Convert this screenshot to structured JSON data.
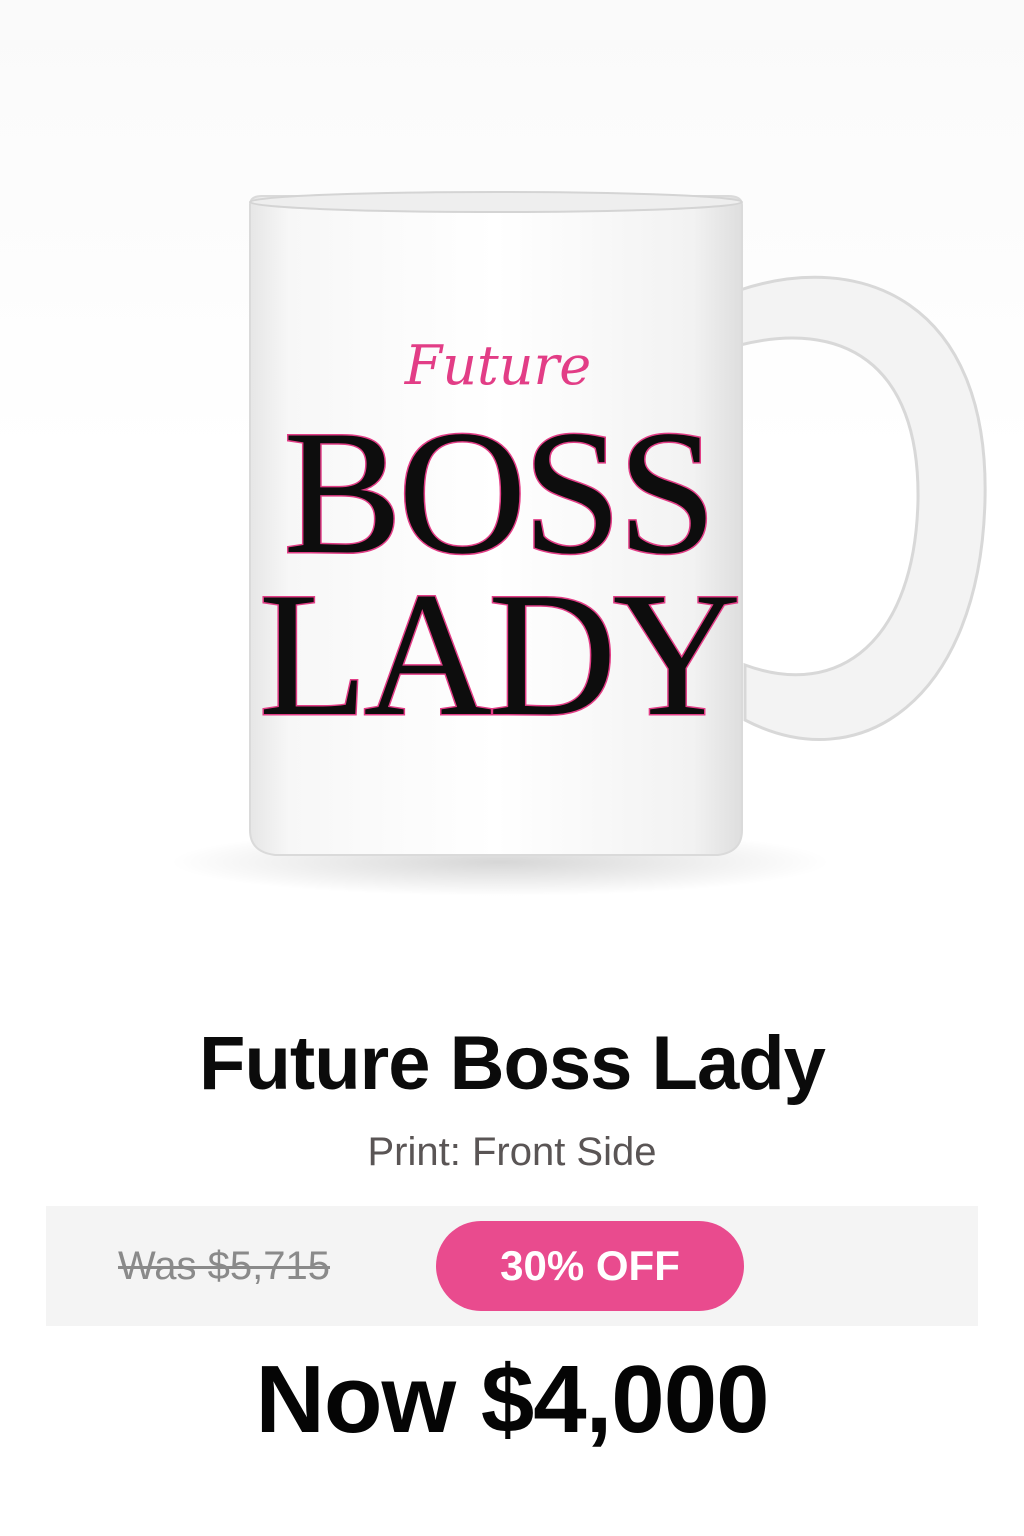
{
  "product": {
    "title": "Future Boss Lady",
    "print_option": "Print: Front Side",
    "image": {
      "description_icon": "mug-image",
      "print_text": {
        "line1": "Future",
        "line2": "BOSS",
        "line3": "LADY"
      }
    }
  },
  "pricing": {
    "was_price": "Was $5,715",
    "discount": "30% OFF",
    "now_price": "Now $4,000"
  },
  "colors": {
    "accent": "#e94b8e",
    "print_pink": "#e23d86",
    "text_dark": "#0b0b0b",
    "muted": "#8a8a8a"
  }
}
